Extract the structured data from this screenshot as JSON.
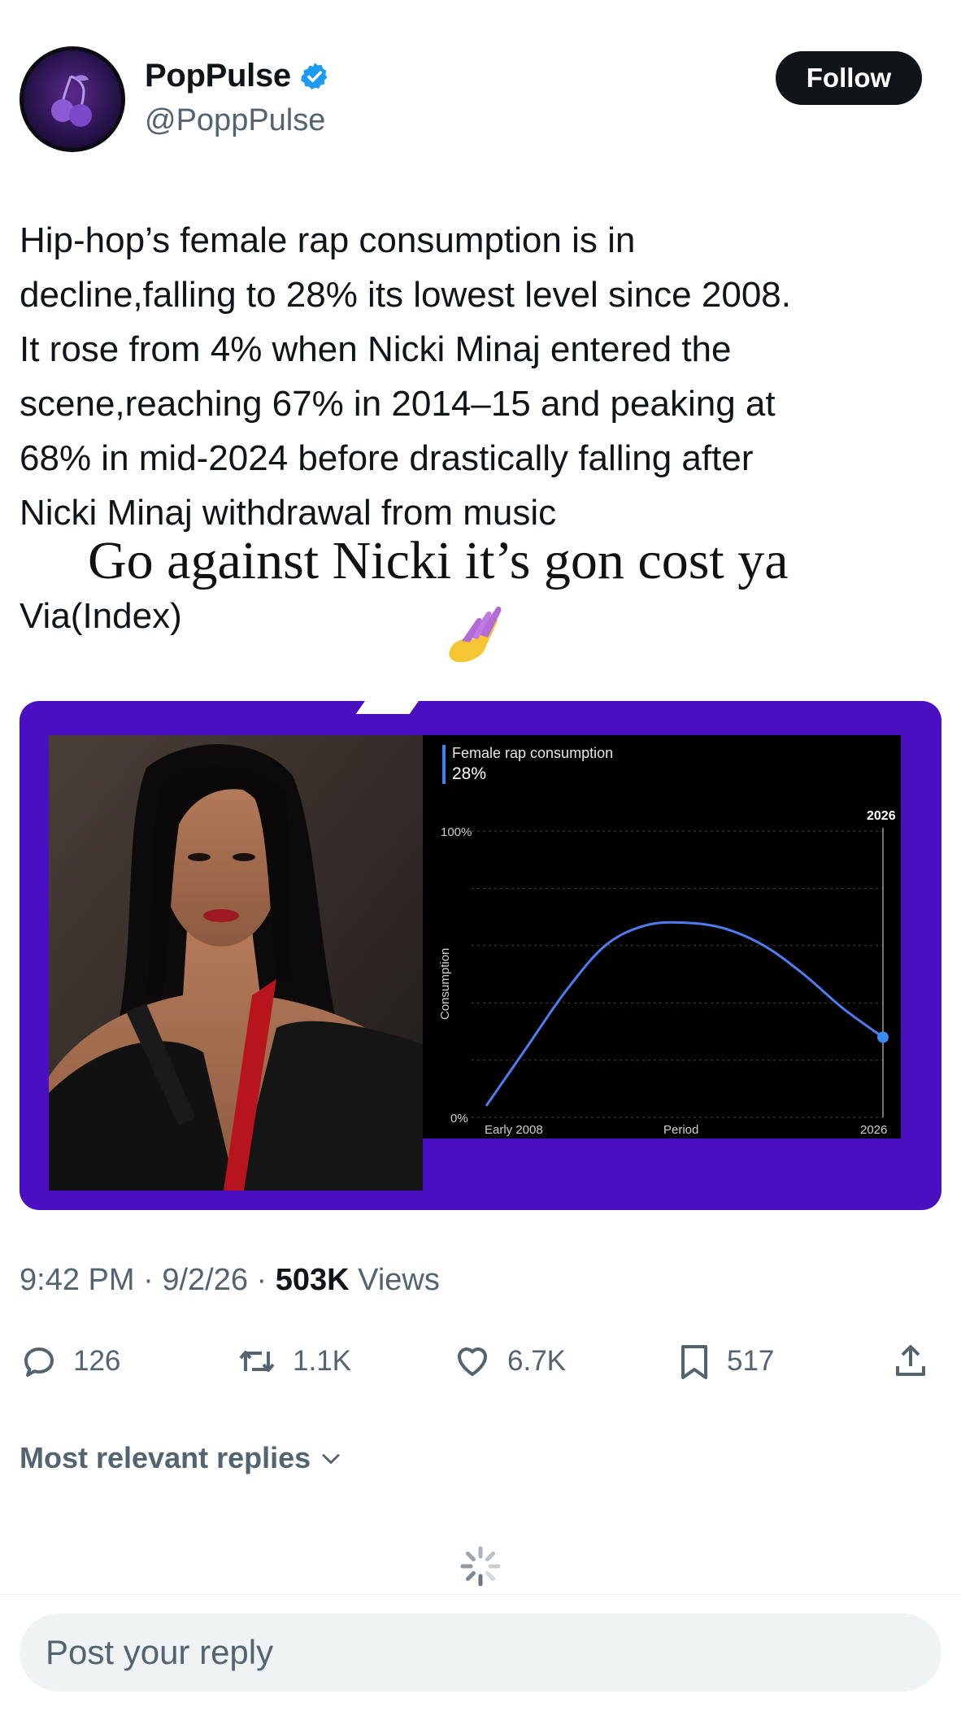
{
  "author": {
    "display_name": "PopPulse",
    "handle": "@PoppPulse",
    "verified": true,
    "avatar_icon": "cherry-icon",
    "follow_label": "Follow"
  },
  "tweet": {
    "lines": [
      "Hip-hop’s female rap consumption is in",
      "decline,falling to 28% its lowest level since 2008.",
      "It rose from 4% when Nicki Minaj entered the",
      "scene,reaching 67% in 2014–15 and peaking at",
      "68% in mid-2024 before drastically falling after",
      "Nicki Minaj  withdrawal from music"
    ],
    "overlay_text": "Go against Nicki it’s gon cost ya",
    "via": "Via(Index)",
    "emoji": "nail-polish-emoji"
  },
  "media": {
    "photo_subject": "portrait-photo",
    "chart_data": {
      "type": "line",
      "title": "Female rap consumption",
      "subtitle": "28%",
      "ylabel": "Consumption",
      "xlabel": "Period",
      "x_ticks": [
        "Early 2008",
        "Period",
        "2026"
      ],
      "y_ticks": [
        "0%",
        "100%"
      ],
      "ylim": [
        0,
        100
      ],
      "marker_label": "2026",
      "grid": true,
      "x": [
        0,
        0.1,
        0.2,
        0.3,
        0.4,
        0.5,
        0.6,
        0.7,
        0.8,
        0.9,
        1.0
      ],
      "values": [
        4,
        24,
        44,
        60,
        67,
        68,
        66,
        60,
        50,
        38,
        28
      ],
      "line_color": "#4f7df0",
      "highlight_point": {
        "x": 1.0,
        "y": 28
      }
    }
  },
  "meta": {
    "time": "9:42 PM",
    "date": "9/2/26",
    "views_count": "503K",
    "views_label": "Views"
  },
  "actions": {
    "replies": "126",
    "reposts": "1.1K",
    "likes": "6.7K",
    "bookmarks": "517"
  },
  "replies_section": {
    "label": "Most relevant replies"
  },
  "reply_input": {
    "placeholder": "Post your reply"
  },
  "colors": {
    "media_frame": "#4a0fc0",
    "verified_badge": "#1d9bf0",
    "text_primary": "#0f1419",
    "text_secondary": "#536471"
  }
}
